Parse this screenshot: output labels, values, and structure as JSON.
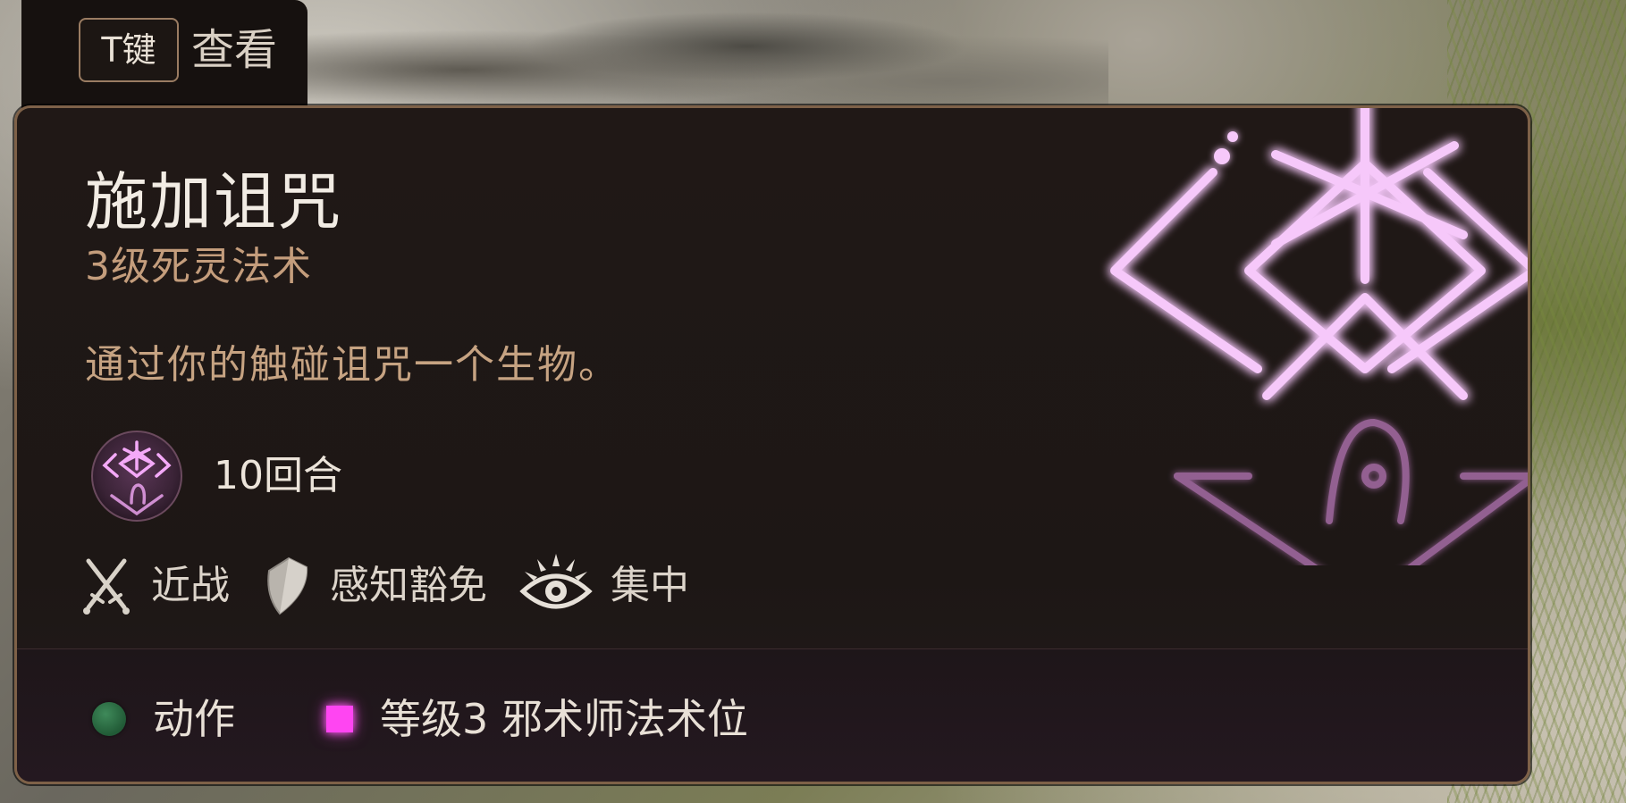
{
  "keybind": {
    "key": "T键",
    "action": "查看"
  },
  "spell": {
    "name": "施加诅咒",
    "level_school": "3级死灵法术",
    "description": "通过你的触碰诅咒一个生物。",
    "duration": "10回合",
    "icon": "curse-sigil-icon"
  },
  "tags": [
    {
      "label": "近战",
      "icon": "crossed-swords-icon"
    },
    {
      "label": "感知豁免",
      "icon": "shield-icon"
    },
    {
      "label": "集中",
      "icon": "concentration-eye-icon"
    }
  ],
  "costs": [
    {
      "label": "动作",
      "icon": "action-dot-icon",
      "color": "#2f7a4a"
    },
    {
      "label": "等级3 邪术师法术位",
      "icon": "spell-slot-square-icon",
      "color": "#ff45f2"
    }
  ],
  "colors": {
    "panel_border": "#7e6148",
    "title": "#f2ece4",
    "subtitle": "#c49d7c",
    "sigil_glow": "#e46cf0"
  }
}
